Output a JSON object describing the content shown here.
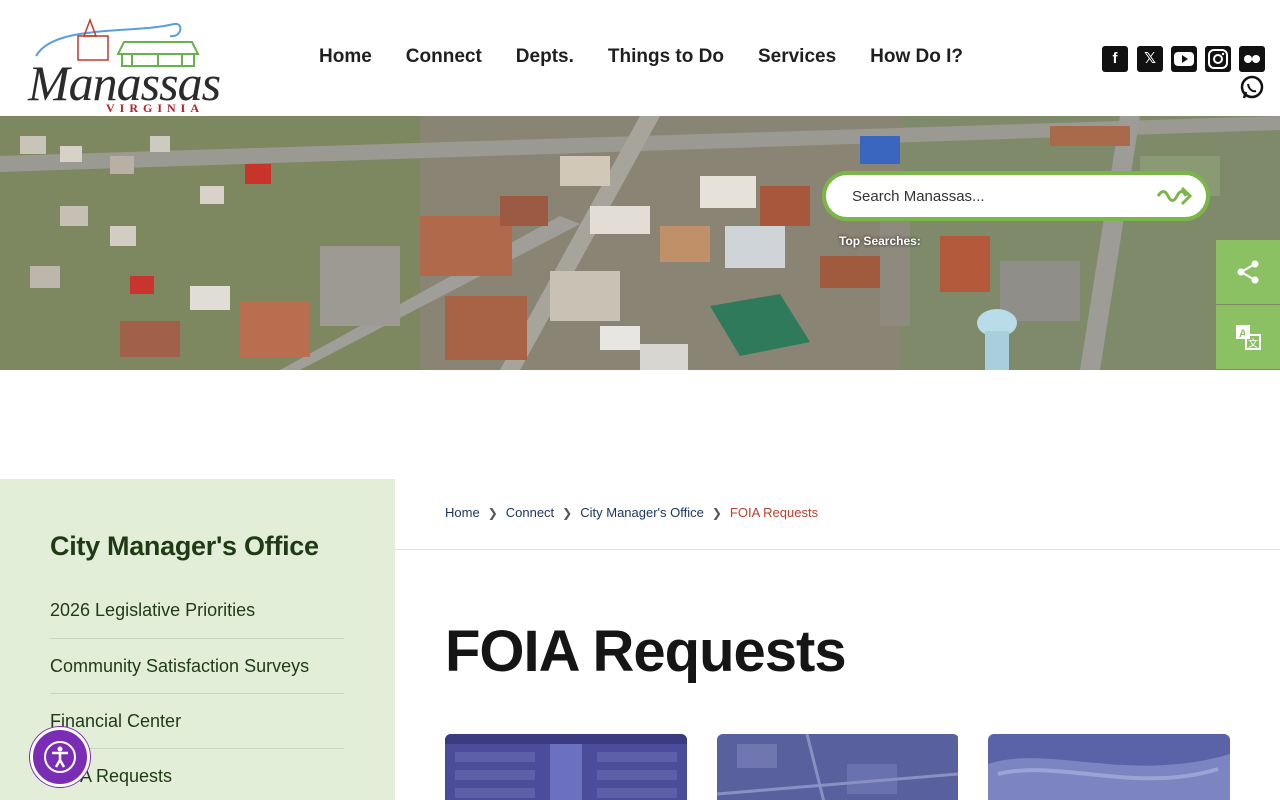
{
  "logo": {
    "word": "Manassas",
    "sub": "VIRGINIA"
  },
  "nav": [
    {
      "label": "Home"
    },
    {
      "label": "Connect"
    },
    {
      "label": "Depts."
    },
    {
      "label": "Things to Do"
    },
    {
      "label": "Services"
    },
    {
      "label": "How Do I?"
    }
  ],
  "social": [
    "facebook-icon",
    "x-icon",
    "youtube-icon",
    "instagram-icon",
    "flickr-icon",
    "whatsapp-icon"
  ],
  "search": {
    "placeholder": "Search Manassas...",
    "top_searches_label": "Top Searches:"
  },
  "side_buttons": [
    "share-icon",
    "translate-icon"
  ],
  "sidebar": {
    "title": "City Manager's Office",
    "items": [
      {
        "label": "2026 Legislative Priorities"
      },
      {
        "label": "Community Satisfaction Surveys"
      },
      {
        "label": "Financial Center"
      },
      {
        "label": "FOIA Requests"
      }
    ]
  },
  "breadcrumb": {
    "items": [
      {
        "label": "Home"
      },
      {
        "label": "Connect"
      },
      {
        "label": "City Manager's Office"
      }
    ],
    "current": "FOIA Requests"
  },
  "page": {
    "title": "FOIA Requests"
  },
  "colors": {
    "accent_green": "#7ab648",
    "sidebar_bg": "#e3eed9",
    "current_crumb": "#b9402e",
    "a11y_purple": "#7b2cb5"
  }
}
